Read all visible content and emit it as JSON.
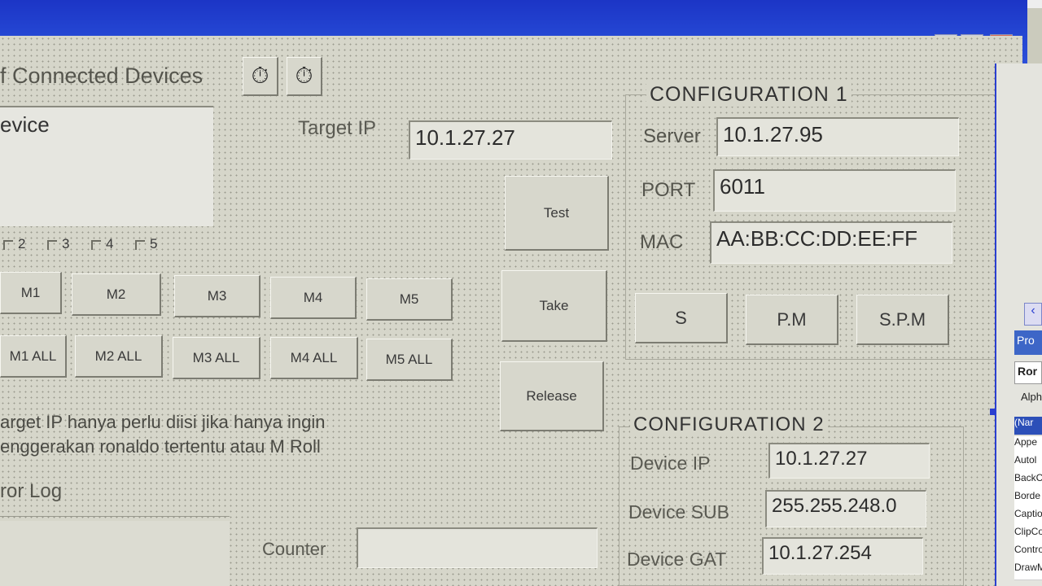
{
  "devices": {
    "header": "f Connected Devices",
    "list_header": "evice"
  },
  "target_ip": {
    "label": "Target IP",
    "value": "10.1.27.27"
  },
  "checkboxes": [
    "2",
    "3",
    "4",
    "5"
  ],
  "actions": {
    "test": "Test",
    "take": "Take",
    "release": "Release"
  },
  "motor_buttons": [
    "M1",
    "M2",
    "M3",
    "M4",
    "M5"
  ],
  "motor_all_buttons": [
    "M1 ALL",
    "M2 ALL",
    "M3 ALL",
    "M4 ALL",
    "M5 ALL"
  ],
  "note": {
    "line1": "arget IP hanya perlu diisi jika hanya ingin",
    "line2": "enggerakan ronaldo tertentu atau M Roll"
  },
  "error_log": {
    "label": "ror Log"
  },
  "counter": {
    "label": "Counter",
    "value": ""
  },
  "config1": {
    "title": "CONFIGURATION 1",
    "server_label": "Server",
    "server_value": "10.1.27.95",
    "port_label": "PORT",
    "port_value": "6011",
    "mac_label": "MAC",
    "mac_value": "AA:BB:CC:DD:EE:FF",
    "buttons": [
      "S",
      "P.M",
      "S.P.M"
    ]
  },
  "config2": {
    "title": "CONFIGURATION 2",
    "ip_label": "Device IP",
    "ip_value": "10.1.27.27",
    "sub_label": "Device SUB",
    "sub_value": "255.255.248.0",
    "gat_label": "Device GAT",
    "gat_value": "10.1.27.254"
  },
  "properties": {
    "tab": "Pro",
    "object": "Ror",
    "sort": "Alph",
    "items": [
      "(Nar",
      "Appe",
      "Autol",
      "BackC",
      "Borde",
      "Captio",
      "ClipCor",
      "Control",
      "DrawM"
    ]
  },
  "icons": {
    "timer": "stopwatch-icon",
    "close": "close-icon",
    "minimize": "minimize-icon",
    "maximize": "maximize-icon"
  },
  "colors": {
    "titlebar": "#2446d3",
    "form": "#d6d6ca"
  }
}
